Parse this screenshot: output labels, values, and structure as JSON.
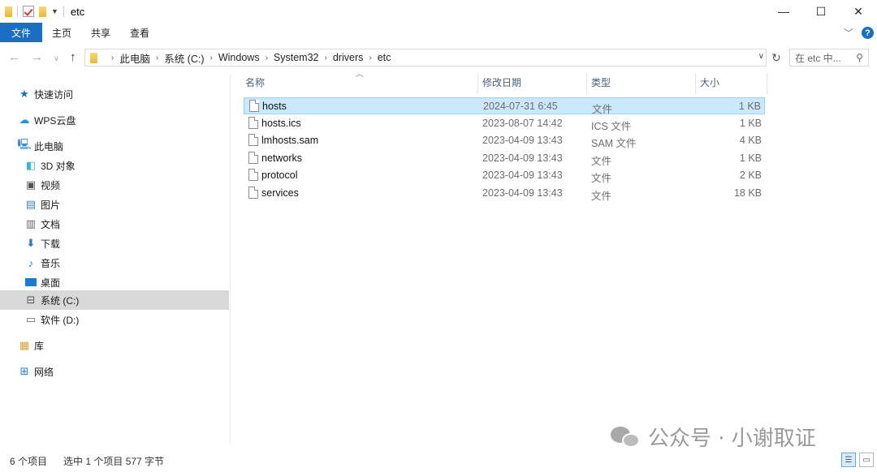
{
  "window": {
    "title": "etc",
    "minimize": "—",
    "maximize": "☐",
    "close": "✕"
  },
  "ribbon": {
    "tabs": [
      "文件",
      "主页",
      "共享",
      "查看"
    ]
  },
  "address": {
    "crumbs": [
      "此电脑",
      "系统 (C:)",
      "Windows",
      "System32",
      "drivers",
      "etc"
    ],
    "search_placeholder": "在 etc 中..."
  },
  "nav": {
    "items": [
      {
        "label": "快速访问",
        "icon": "star-icon"
      },
      {
        "label": "WPS云盘",
        "icon": "cloud-icon"
      },
      {
        "label": "此电脑",
        "icon": "computer-icon"
      },
      {
        "label": "3D 对象",
        "icon": "cube-icon"
      },
      {
        "label": "视频",
        "icon": "video-icon"
      },
      {
        "label": "图片",
        "icon": "picture-icon"
      },
      {
        "label": "文档",
        "icon": "document-icon"
      },
      {
        "label": "下载",
        "icon": "download-icon"
      },
      {
        "label": "音乐",
        "icon": "music-icon"
      },
      {
        "label": "桌面",
        "icon": "desktop-icon"
      },
      {
        "label": "系统 (C:)",
        "icon": "drive-c-icon"
      },
      {
        "label": "软件 (D:)",
        "icon": "drive-d-icon"
      },
      {
        "label": "库",
        "icon": "library-icon"
      },
      {
        "label": "网络",
        "icon": "network-icon"
      }
    ]
  },
  "list": {
    "columns": [
      "名称",
      "修改日期",
      "类型",
      "大小"
    ],
    "rows": [
      {
        "name": "hosts",
        "date": "2024-07-31 6:45",
        "type": "文件",
        "size": "1 KB"
      },
      {
        "name": "hosts.ics",
        "date": "2023-08-07 14:42",
        "type": "ICS 文件",
        "size": "1 KB"
      },
      {
        "name": "lmhosts.sam",
        "date": "2023-04-09 13:43",
        "type": "SAM 文件",
        "size": "4 KB"
      },
      {
        "name": "networks",
        "date": "2023-04-09 13:43",
        "type": "文件",
        "size": "1 KB"
      },
      {
        "name": "protocol",
        "date": "2023-04-09 13:43",
        "type": "文件",
        "size": "2 KB"
      },
      {
        "name": "services",
        "date": "2023-04-09 13:43",
        "type": "文件",
        "size": "18 KB"
      }
    ]
  },
  "status": {
    "count": "6 个项目",
    "selection": "选中 1 个项目  577 字节"
  },
  "watermark": {
    "text": "公众号 · 小谢取证"
  },
  "colors": {
    "accent": "#1a6fc2",
    "selection": "#cce8ff"
  }
}
